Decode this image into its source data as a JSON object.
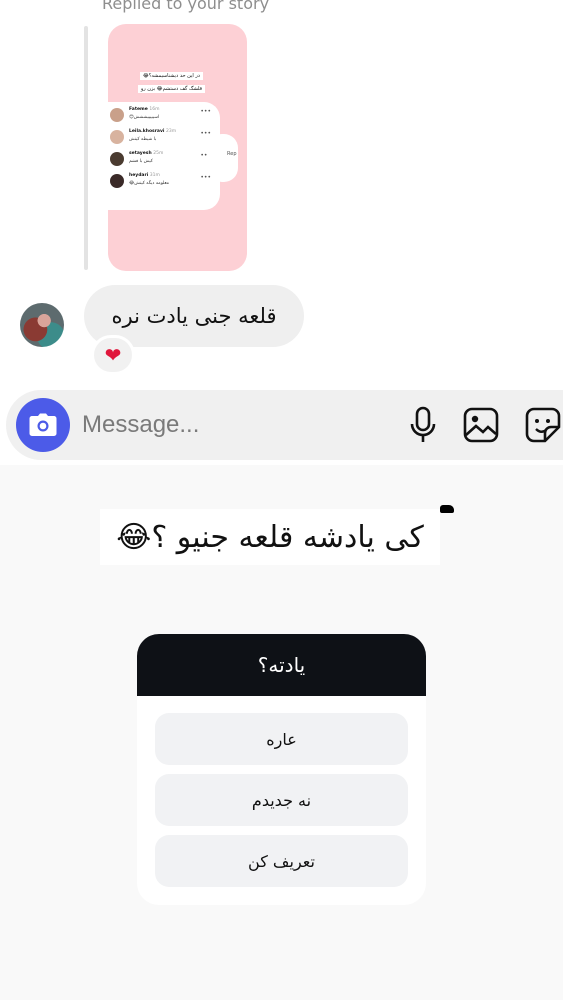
{
  "chat": {
    "replied_label": "Replied to your story",
    "story": {
      "stickers": [
        "در این حد دیشناسیمشه؟😂",
        "قلشگ گف دستشم😂 بزن رو"
      ],
      "comments": [
        {
          "name": "Fateme",
          "time": "16m",
          "text": "اسیییییششش😍"
        },
        {
          "name": "Leila.khosravi",
          "time": "23m",
          "text": "با شیطه کینش"
        },
        {
          "name": "setayesh",
          "time": "25m",
          "text": "کیش با فشم"
        },
        {
          "name": "heydari",
          "time": "31m",
          "text": "معلومه دیگه کینش😂"
        }
      ],
      "reply_label": "Rep"
    },
    "message": "قلعه جنی یادت نره",
    "reaction": "❤",
    "composer": {
      "placeholder": "Message..."
    }
  },
  "question": "کی یادشه قلعه جنیو ؟😂",
  "poll": {
    "title": "یادته؟",
    "options": [
      "عاره",
      "نه جدیدم",
      "تعریف کن"
    ]
  },
  "colors": {
    "camera_button": "#4c5be8",
    "poll_header": "#0e1116",
    "story_bg": "#fdd0d5",
    "reaction": "#e0163b"
  },
  "icons": [
    "camera-icon",
    "microphone-icon",
    "gallery-icon",
    "sticker-icon",
    "heart-icon"
  ]
}
